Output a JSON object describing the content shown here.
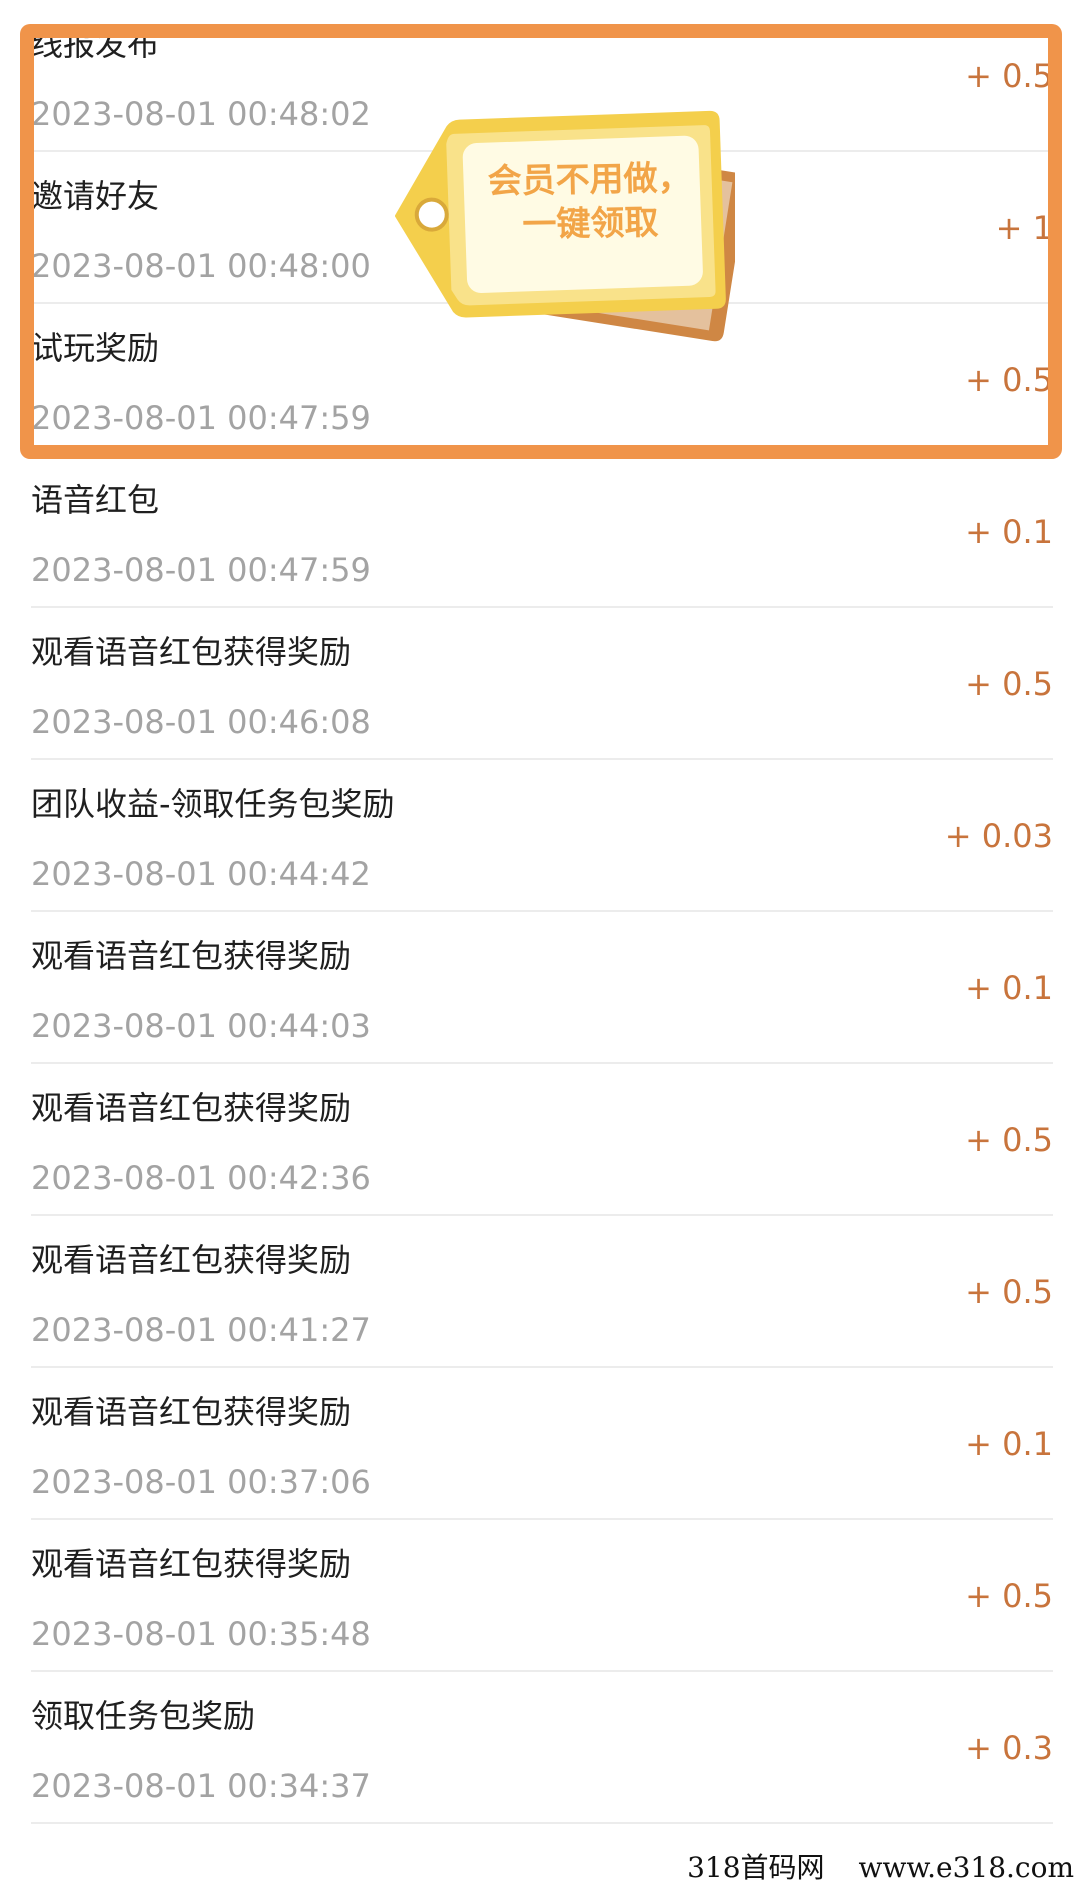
{
  "records": [
    {
      "title": "线报发布",
      "time": "2023-08-01 00:48:02",
      "amount": "+ 0.5"
    },
    {
      "title": "邀请好友",
      "time": "2023-08-01 00:48:00",
      "amount": "+ 1"
    },
    {
      "title": "试玩奖励",
      "time": "2023-08-01 00:47:59",
      "amount": "+ 0.5"
    },
    {
      "title": "语音红包",
      "time": "2023-08-01 00:47:59",
      "amount": "+ 0.1"
    },
    {
      "title": "观看语音红包获得奖励",
      "time": "2023-08-01 00:46:08",
      "amount": "+ 0.5"
    },
    {
      "title": "团队收益-领取任务包奖励",
      "time": "2023-08-01 00:44:42",
      "amount": "+ 0.03"
    },
    {
      "title": "观看语音红包获得奖励",
      "time": "2023-08-01 00:44:03",
      "amount": "+ 0.1"
    },
    {
      "title": "观看语音红包获得奖励",
      "time": "2023-08-01 00:42:36",
      "amount": "+ 0.5"
    },
    {
      "title": "观看语音红包获得奖励",
      "time": "2023-08-01 00:41:27",
      "amount": "+ 0.5"
    },
    {
      "title": "观看语音红包获得奖励",
      "time": "2023-08-01 00:37:06",
      "amount": "+ 0.1"
    },
    {
      "title": "观看语音红包获得奖励",
      "time": "2023-08-01 00:35:48",
      "amount": "+ 0.5"
    },
    {
      "title": "领取任务包奖励",
      "time": "2023-08-01 00:34:37",
      "amount": "+ 0.3"
    }
  ],
  "promo_tag": {
    "line1": "会员不用做，",
    "line2": "一键领取"
  },
  "watermark": {
    "site_name": "318首码网",
    "site_url": "www.e318.com"
  },
  "colors": {
    "highlight_border": "#f0944a",
    "amount": "#c8743c",
    "tag_text": "#f2a548"
  }
}
